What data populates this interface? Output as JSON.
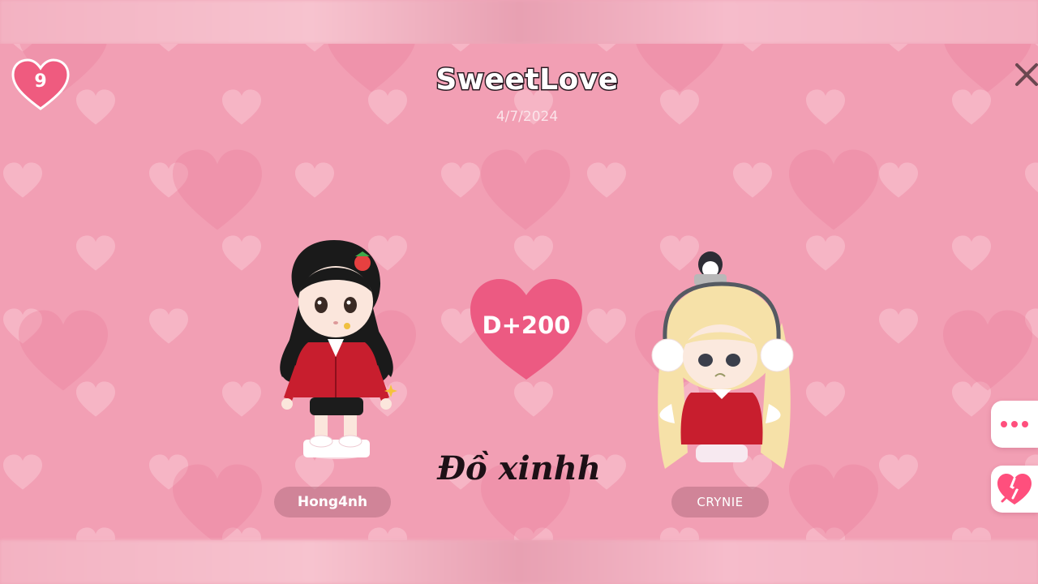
{
  "header": {
    "title": "SweetLove",
    "date": "4/7/2024"
  },
  "level": {
    "value": "9",
    "icon": "heart-icon"
  },
  "anniversary": {
    "days_label": "D+200",
    "icon": "heart-icon"
  },
  "caption": "Đồ xinhh",
  "partners": [
    {
      "name": "Hong4nh"
    },
    {
      "name": "CRYNIE"
    }
  ],
  "side_buttons": [
    {
      "icon": "more-dots-icon"
    },
    {
      "icon": "broken-heart-icon"
    }
  ],
  "colors": {
    "background": "#f29fb4",
    "heart_light": "#f7bccb",
    "heart_dark": "#ea7f9b",
    "accent": "#ff4f7d",
    "badge": "#ef5b7f"
  }
}
